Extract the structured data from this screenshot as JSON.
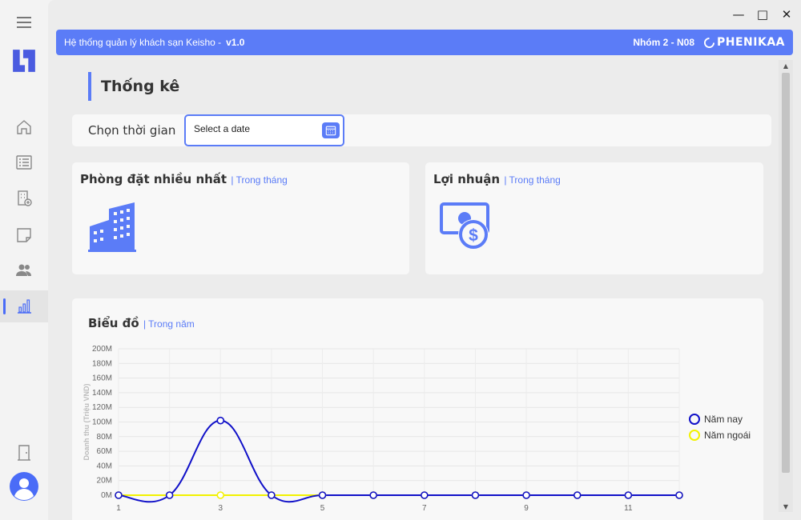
{
  "window": {
    "minimize_glyph": "—",
    "maximize_glyph": "□",
    "close_glyph": "✕"
  },
  "titlebar": {
    "app_title": "Hệ thống quản lý khách sạn Keisho -",
    "version": "v1.0",
    "group": "Nhóm 2 - N08",
    "brand": "PHENIKAA"
  },
  "sidebar": {
    "items": [
      {
        "name": "menu-icon"
      },
      {
        "name": "app-logo"
      },
      {
        "name": "home-icon"
      },
      {
        "name": "list-icon"
      },
      {
        "name": "room-add-icon"
      },
      {
        "name": "note-icon"
      },
      {
        "name": "users-icon"
      },
      {
        "name": "chart-icon",
        "active": true
      },
      {
        "name": "door-exit-icon"
      },
      {
        "name": "avatar"
      }
    ]
  },
  "page": {
    "title": "Thống kê",
    "date_label": "Chọn thời gian",
    "date_placeholder": "Select a date"
  },
  "cards": {
    "most_booked": {
      "title": "Phòng đặt nhiều nhất",
      "subtitle": "| Trong tháng"
    },
    "profit": {
      "title": "Lợi nhuận",
      "subtitle": "| Trong tháng"
    },
    "chart": {
      "title": "Biểu đồ",
      "subtitle": "| Trong năm"
    }
  },
  "colors": {
    "accent": "#5b7cf7",
    "series_current": "#1010c8",
    "series_previous": "#f2f200"
  },
  "chart_data": {
    "type": "line",
    "title": "Biểu đồ",
    "ylabel": "Doanh thu (Triệu VND)",
    "xlabel": "",
    "x": [
      1,
      2,
      3,
      4,
      5,
      6,
      7,
      8,
      9,
      10,
      11,
      12
    ],
    "x_tick_labels": [
      "1",
      "3",
      "5",
      "7",
      "9",
      "11"
    ],
    "y_tick_labels": [
      "0M",
      "20M",
      "40M",
      "60M",
      "80M",
      "100M",
      "120M",
      "140M",
      "160M",
      "180M",
      "200M"
    ],
    "ylim": [
      0,
      200
    ],
    "smooth": true,
    "grid": true,
    "legend_position": "right",
    "series": [
      {
        "name": "Năm nay",
        "values": [
          0,
          0,
          102,
          0,
          0,
          0,
          0,
          0,
          0,
          0,
          0,
          0
        ]
      },
      {
        "name": "Năm ngoái",
        "values": [
          0,
          0,
          0,
          0,
          0,
          0,
          0,
          0,
          0,
          0,
          0,
          0
        ]
      }
    ]
  }
}
